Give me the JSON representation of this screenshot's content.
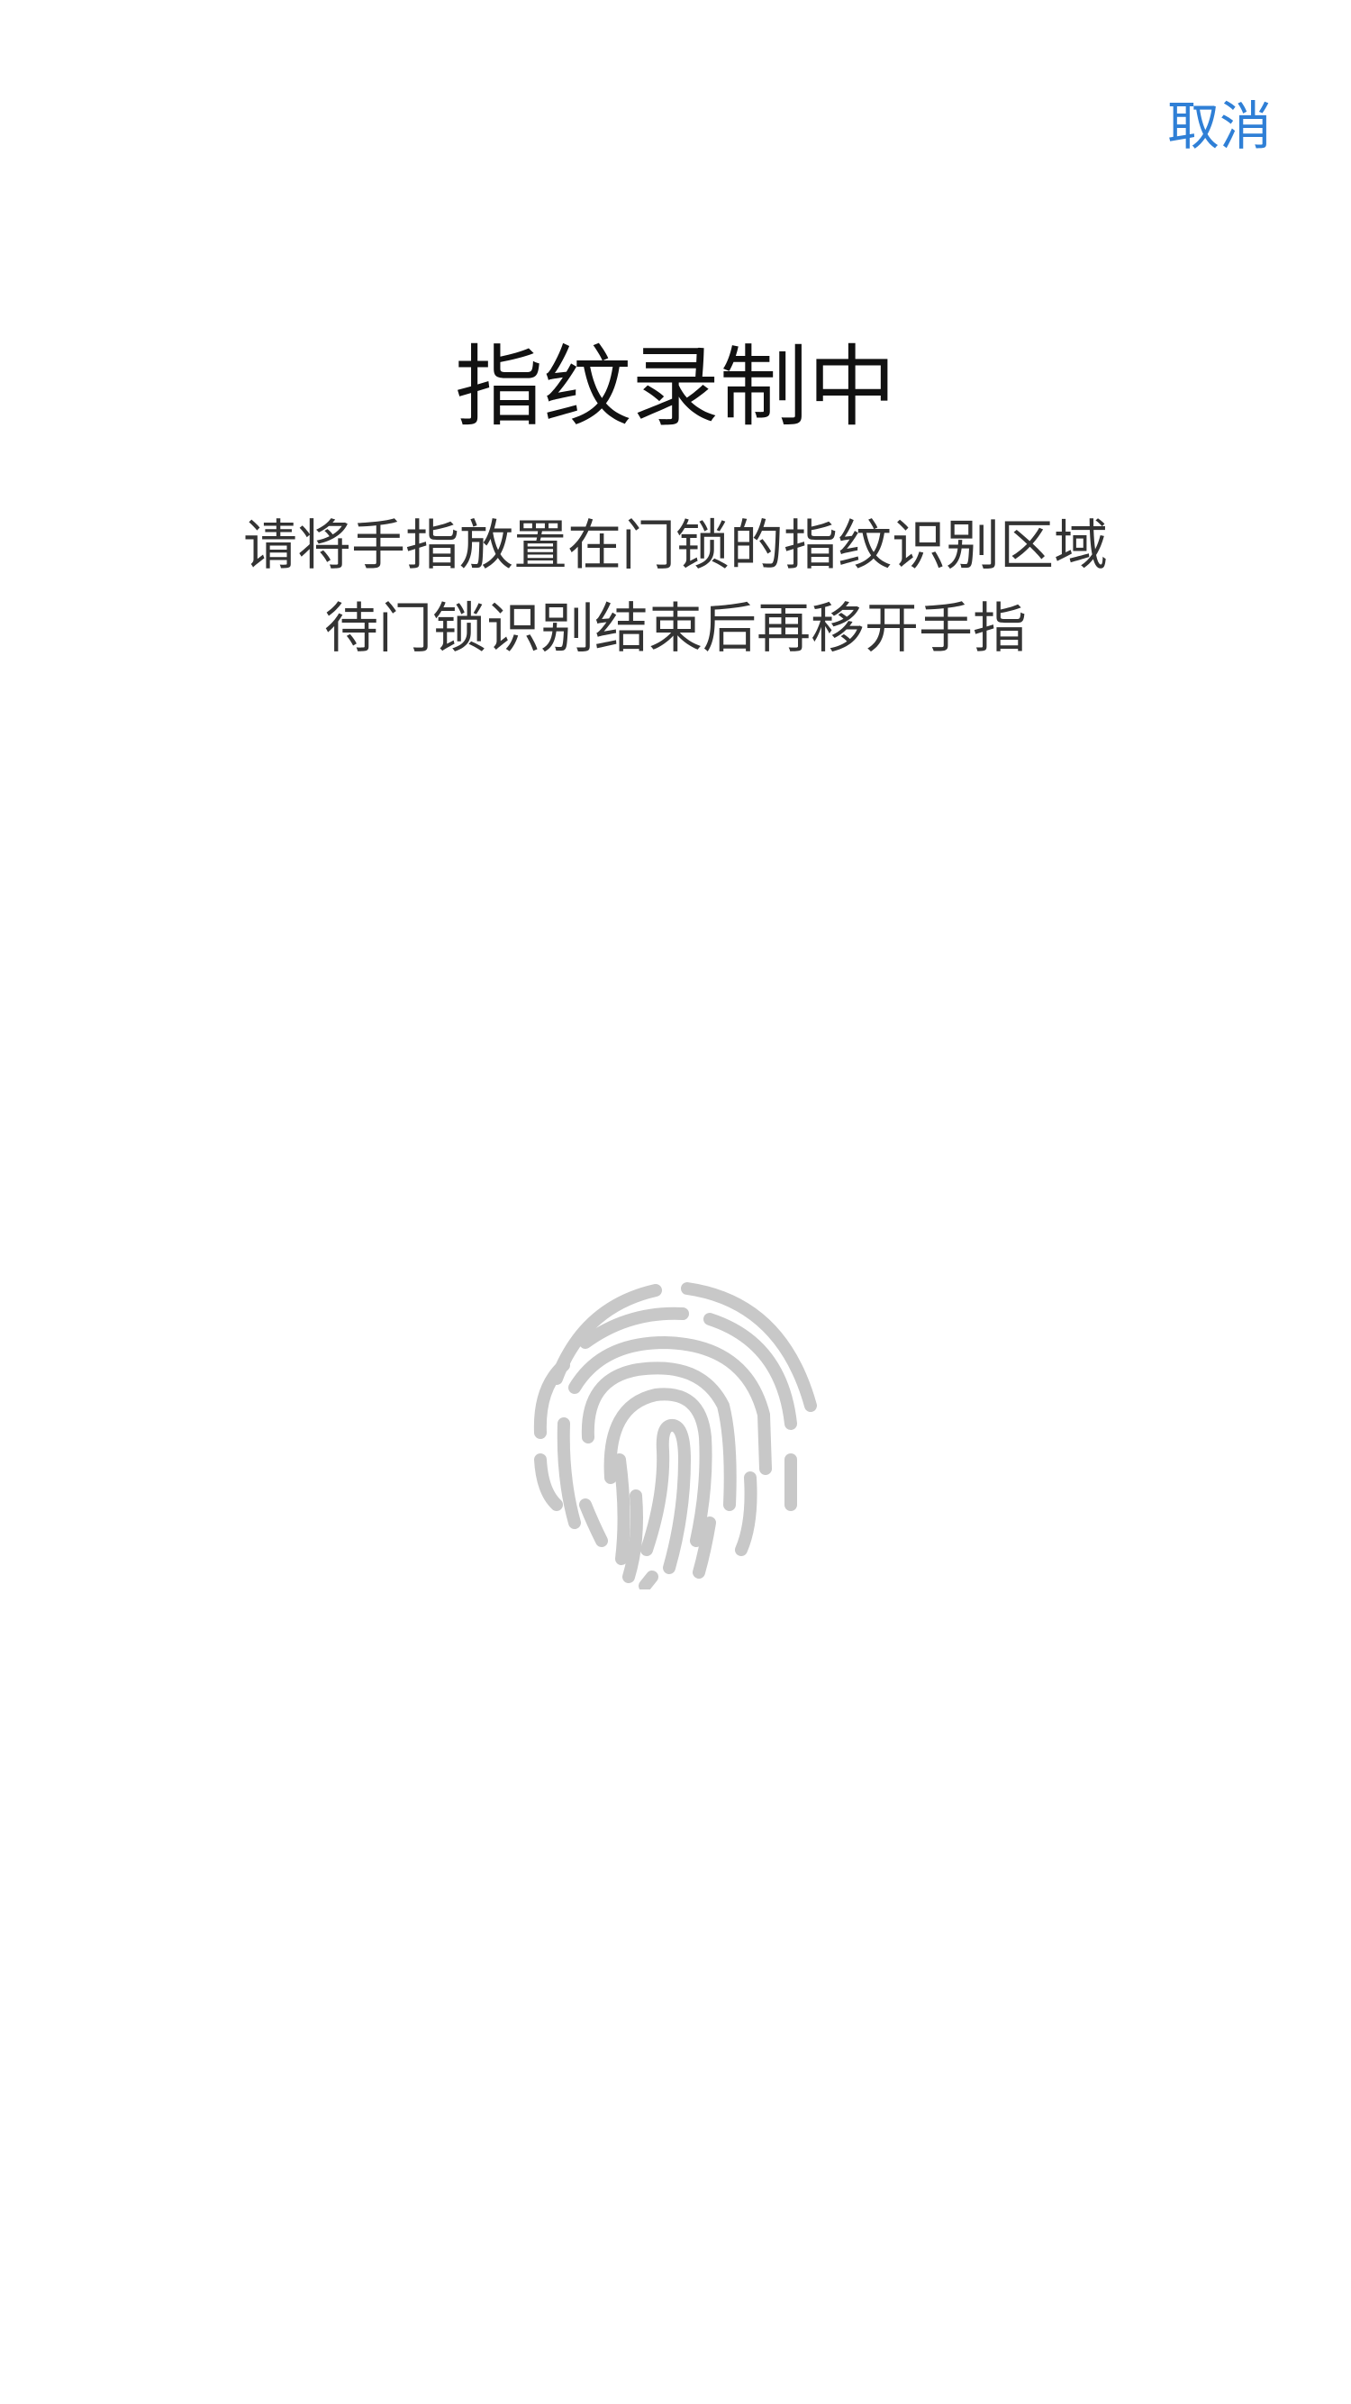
{
  "header": {
    "cancel_label": "取消"
  },
  "main": {
    "title": "指纹录制中",
    "instruction_line1": "请将手指放置在门锁的指纹识别区域",
    "instruction_line2": "待门锁识别结束后再移开手指",
    "icon": "fingerprint-icon"
  },
  "colors": {
    "accent": "#2f7fd6",
    "title": "#111111",
    "text": "#333333",
    "icon": "#c8c8c8",
    "background": "#ffffff"
  }
}
